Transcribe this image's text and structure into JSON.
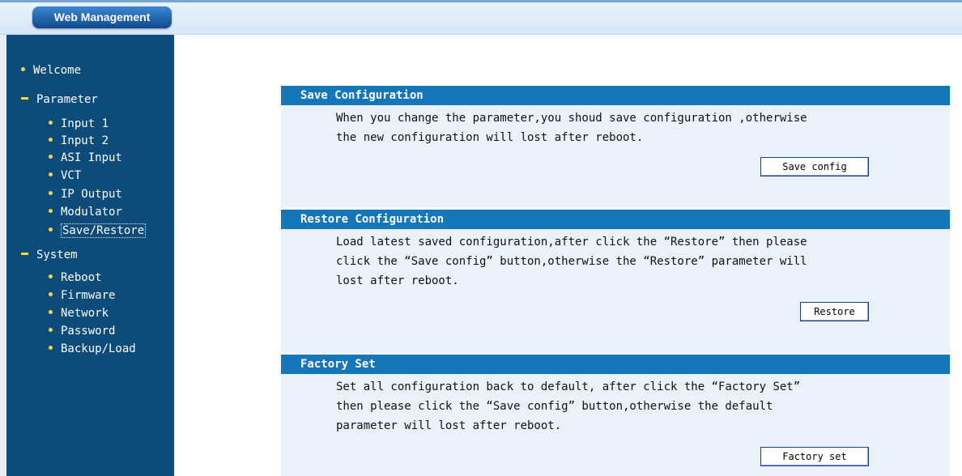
{
  "header": {
    "brand": "Web Management"
  },
  "sidebar": {
    "welcome": "Welcome",
    "parameter": "Parameter",
    "parameter_items": [
      "Input 1",
      "Input 2",
      "ASI Input",
      "VCT",
      "IP Output",
      "Modulator",
      "Save/Restore"
    ],
    "system": "System",
    "system_items": [
      "Reboot",
      "Firmware",
      "Network",
      "Password",
      "Backup/Load"
    ],
    "active_item": "Save/Restore"
  },
  "sections": {
    "save": {
      "title": "Save Configuration",
      "lines": [
        "When you change the parameter,you shoud save configuration ,otherwise",
        "the new configuration will lost after reboot."
      ],
      "button": "Save config"
    },
    "restore": {
      "title": "Restore Configuration",
      "lines": [
        "Load latest saved configuration,after click the “Restore” then please",
        "click the “Save config” button,otherwise the “Restore” parameter will",
        "lost after reboot."
      ],
      "button": "Restore"
    },
    "factory": {
      "title": "Factory Set",
      "lines": [
        "Set all configuration back to default, after click the “Factory Set”",
        "then please click the “Save config” button,otherwise the default",
        "parameter will lost after reboot."
      ],
      "button": "Factory set"
    }
  },
  "colors": {
    "sidebar_bg": "#0c4b7a",
    "section_header_bg": "#1576b8",
    "section_body_bg": "#eaf1f9",
    "bullet": "#f7d44a"
  }
}
